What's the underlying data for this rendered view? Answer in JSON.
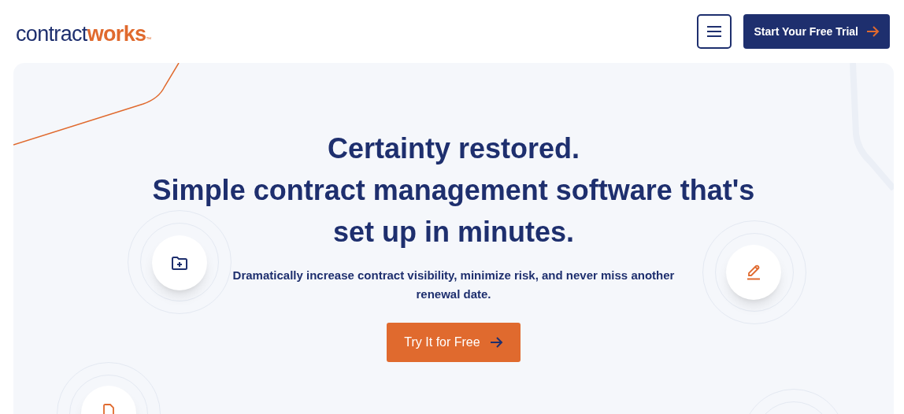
{
  "header": {
    "logo": {
      "part_1": "contract",
      "part_2": "works",
      "mark": "™"
    },
    "cta": {
      "label": "Start Your Free Trial"
    }
  },
  "hero": {
    "headline": [
      "Certainty restored.",
      "Simple contract management software that's",
      "set up in minutes."
    ],
    "subtitle": "Dramatically increase contract visibility, minimize risk, and never miss another renewal date.",
    "button": {
      "label": "Try It for Free"
    }
  }
}
